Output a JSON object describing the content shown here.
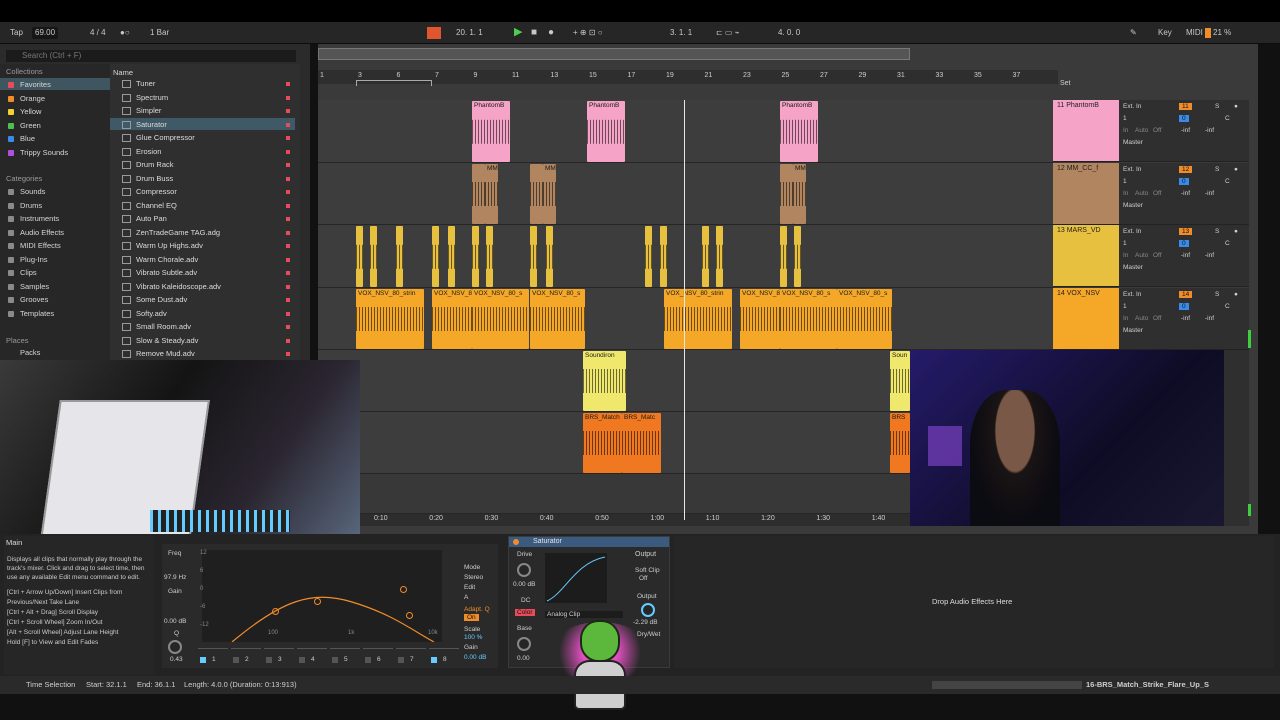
{
  "top_strip": {
    "tap": "Tap",
    "tempo": "69.00",
    "time_sig": "4 / 4",
    "quantize": "1 Bar",
    "position": "20.  1.  1",
    "loop_start": "3.  1.  1",
    "loop_length": "4.  0.  0",
    "key": "Key",
    "midi": "MIDI",
    "cpu": "21 %"
  },
  "browser": {
    "search_placeholder": "Search (Ctrl + F)",
    "collections_header": "Collections",
    "collections": [
      {
        "label": "Favorites",
        "color": "#e84c5a"
      },
      {
        "label": "Orange",
        "color": "#f08c2a"
      },
      {
        "label": "Yellow",
        "color": "#f2d22c"
      },
      {
        "label": "Green",
        "color": "#4cc24c"
      },
      {
        "label": "Blue",
        "color": "#3a8ae8"
      },
      {
        "label": "Trippy Sounds",
        "color": "#b050e0"
      }
    ],
    "categories_header": "Categories",
    "categories": [
      "Sounds",
      "Drums",
      "Instruments",
      "Audio Effects",
      "MIDI Effects",
      "Plug-Ins",
      "Clips",
      "Samples",
      "Grooves",
      "Templates"
    ],
    "places_header": "Places",
    "places": [
      "Packs"
    ],
    "name_header": "Name",
    "items": [
      "Tuner",
      "Spectrum",
      "Simpler",
      "Saturator",
      "Glue Compressor",
      "Erosion",
      "Drum Rack",
      "Drum Buss",
      "Compressor",
      "Channel EQ",
      "Auto Pan",
      "ZenTradeGame TAG.adg",
      "Warm Up Highs.adv",
      "Warm Chorale.adv",
      "Vibrato Subtle.adv",
      "Vibrato Kaleidoscope.adv",
      "Some Dust.adv",
      "Softy.adv",
      "Small Room.adv",
      "Slow & Steady.adv",
      "Remove Mud.adv"
    ],
    "selected_index": 3
  },
  "ruler": {
    "bars": [
      "1",
      "3",
      "6",
      "7",
      "9",
      "11",
      "13",
      "15",
      "17",
      "19",
      "21",
      "23",
      "25",
      "27",
      "29",
      "31",
      "33",
      "35",
      "37"
    ],
    "times": [
      "0:10",
      "0:20",
      "0:30",
      "0:40",
      "0:50",
      "1:00",
      "1:10",
      "1:20",
      "1:30",
      "1:40"
    ],
    "set_label": "Set"
  },
  "tracks": [
    {
      "name": "11 PhantomB",
      "color": "#f5a3c7",
      "input": "Ext. In",
      "input_ch": "1",
      "output": "Master",
      "number": "11",
      "vol": "0",
      "pan": "C",
      "send1": "-inf",
      "send2": "-inf",
      "clip_label": "PhantomB"
    },
    {
      "name": "12 MM_CC_f",
      "color": "#b08560",
      "input": "Ext. In",
      "input_ch": "1",
      "output": "Master",
      "number": "12",
      "vol": "0",
      "pan": "C",
      "send1": "-inf",
      "send2": "-inf",
      "clip_label": "MM"
    },
    {
      "name": "13 MARS_VD",
      "color": "#e8c040",
      "input": "Ext. In",
      "input_ch": "1",
      "output": "Master",
      "number": "13",
      "vol": "0",
      "pan": "C",
      "send1": "-inf",
      "send2": "-inf",
      "clip_label": ""
    },
    {
      "name": "14 VOX_NSV",
      "color": "#f5a728",
      "input": "Ext. In",
      "input_ch": "1",
      "output": "Master",
      "number": "14",
      "vol": "0",
      "pan": "C",
      "send1": "-inf",
      "send2": "-inf",
      "clip_label": "VOX_NSV_80_strin"
    }
  ],
  "io_labels": {
    "in": "In",
    "auto": "Auto",
    "off": "Off"
  },
  "extra_clips": {
    "soundiron": "Soundiron",
    "brs": "BRS_Match",
    "brs2": "BRS_Matc",
    "vox_a": "VOX_NSV_80_strin",
    "vox_b": "VOX_NSV_80_st",
    "vox_c": "VOX_NSV_80_s",
    "sound_r": "Soun",
    "brs_r": "BRS"
  },
  "info_panel": {
    "title": "Main",
    "text": "Displays all clips that normally play through the track's mixer. Click and drag to select time, then use any available Edit menu command to edit.",
    "shortcuts": [
      "[Ctrl + Arrow Up/Down] Insert Clips from Previous/Next Take Lane",
      "[Ctrl + Alt + Drag] Scroll Display",
      "[Ctrl + Scroll Wheel] Zoom In/Out",
      "[Alt + Scroll Wheel] Adjust Lane Height",
      "Hold [F] to View and Edit Fades"
    ]
  },
  "eq_device": {
    "freq_label": "Freq",
    "freq_value": "97.9 Hz",
    "gain_label": "Gain",
    "gain_value": "0.00 dB",
    "q_label": "Q",
    "q_value": "0.43",
    "mode_label": "Mode",
    "mode_value": "Stereo",
    "edit_label": "Edit",
    "edit_value": "A",
    "adapt_label": "Adapt. Q",
    "adapt_value": "On",
    "scale_label": "Scale",
    "scale_value": "100 %",
    "gain2_label": "Gain",
    "gain2_value": "0.00 dB",
    "y_axis": [
      "12",
      "6",
      "0",
      "-6",
      "-12"
    ],
    "x_axis": [
      "100",
      "1k",
      "10k"
    ],
    "bands": [
      "1",
      "2",
      "3",
      "4",
      "5",
      "6",
      "7",
      "8"
    ]
  },
  "saturator": {
    "title": "Saturator",
    "drive_label": "Drive",
    "drive_value": "0.00 dB",
    "dc_label": "DC",
    "color_label": "Color",
    "curve_label": "Analog Clip",
    "base_label": "Base",
    "base_value": "0.00",
    "output_label": "Output",
    "soft_clip_label": "Soft Clip",
    "soft_clip_value": "Off",
    "output2_label": "Output",
    "output_value": "-2.29 dB",
    "drywet_label": "Dry/Wet"
  },
  "drop_zone": "Drop Audio Effects Here",
  "status_bar": {
    "selection": "Time Selection",
    "start": "Start: 32.1.1",
    "end": "End: 36.1.1",
    "length": "Length: 4.0.0  (Duration: 0:13:913)",
    "track_name": "16-BRS_Match_Strike_Flare_Up_S"
  },
  "colors": {
    "pink": "#f5a3c7",
    "tan": "#b08560",
    "gold": "#e8c040",
    "orange": "#f5a728",
    "yellow_clip": "#f0e86c",
    "red_orange": "#f07820",
    "accent_orange": "#f08c2a"
  }
}
